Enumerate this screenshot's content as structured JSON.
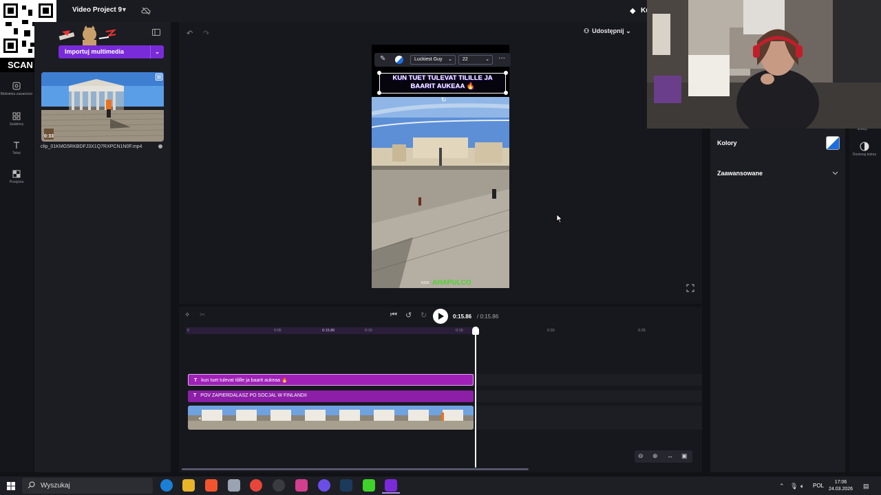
{
  "app": {
    "project_title": "Video Project 9",
    "top_right_partial": "Ku"
  },
  "overlay": {
    "qr_label": "SCAN ME"
  },
  "left_rail": {
    "items": [
      {
        "label": "Biblioteka zawartości",
        "icon": "library-icon"
      },
      {
        "label": "Szablony",
        "icon": "templates-icon"
      },
      {
        "label": "Tekst",
        "icon": "text-icon"
      },
      {
        "label": "Przejścia",
        "icon": "transitions-icon"
      }
    ]
  },
  "media": {
    "import_label": "Importuj multimedia",
    "clip_duration": "0:33",
    "clip_filename": "clip_01KMG5RKBDFJ3X1Q7RXPCN1N0F.mp4"
  },
  "header": {
    "share_label": "Udostępnij"
  },
  "text_toolbar": {
    "font": "Luckiest Guy",
    "size": "22"
  },
  "preview": {
    "caption": "KUN TUET TULEVAT TILILLE JA BAARIT AUKEAA 🔥",
    "watermark_kick": "KICK",
    "watermark_name": "AHAPULCO"
  },
  "playback": {
    "current_time": "0:15.86",
    "total_time": "/ 0:15.86"
  },
  "timeline": {
    "ticks": [
      "0",
      "0:05",
      "0:15.86",
      "0:10",
      "0:15",
      "0:20",
      "0:25"
    ],
    "text_clip_1": "kun tuet tulevat tilille ja baarit aukeaa 🔥",
    "text_clip_2": "POV ZAPIERDALASZ PO SOCJAL W FINLANDII"
  },
  "right_panel": {
    "colors_label": "Kolory",
    "advanced_label": "Zaawansowane",
    "adjust_colors_label": "Dostosuj kolory",
    "effects_label": "Efekty"
  },
  "taskbar": {
    "search_placeholder": "Wyszukaj",
    "language": "POL",
    "time": "17:06",
    "date": "24.03.2026"
  },
  "colors": {
    "accent": "#7a2bd9",
    "text_clip": "#a020b8",
    "bg": "#111216"
  }
}
